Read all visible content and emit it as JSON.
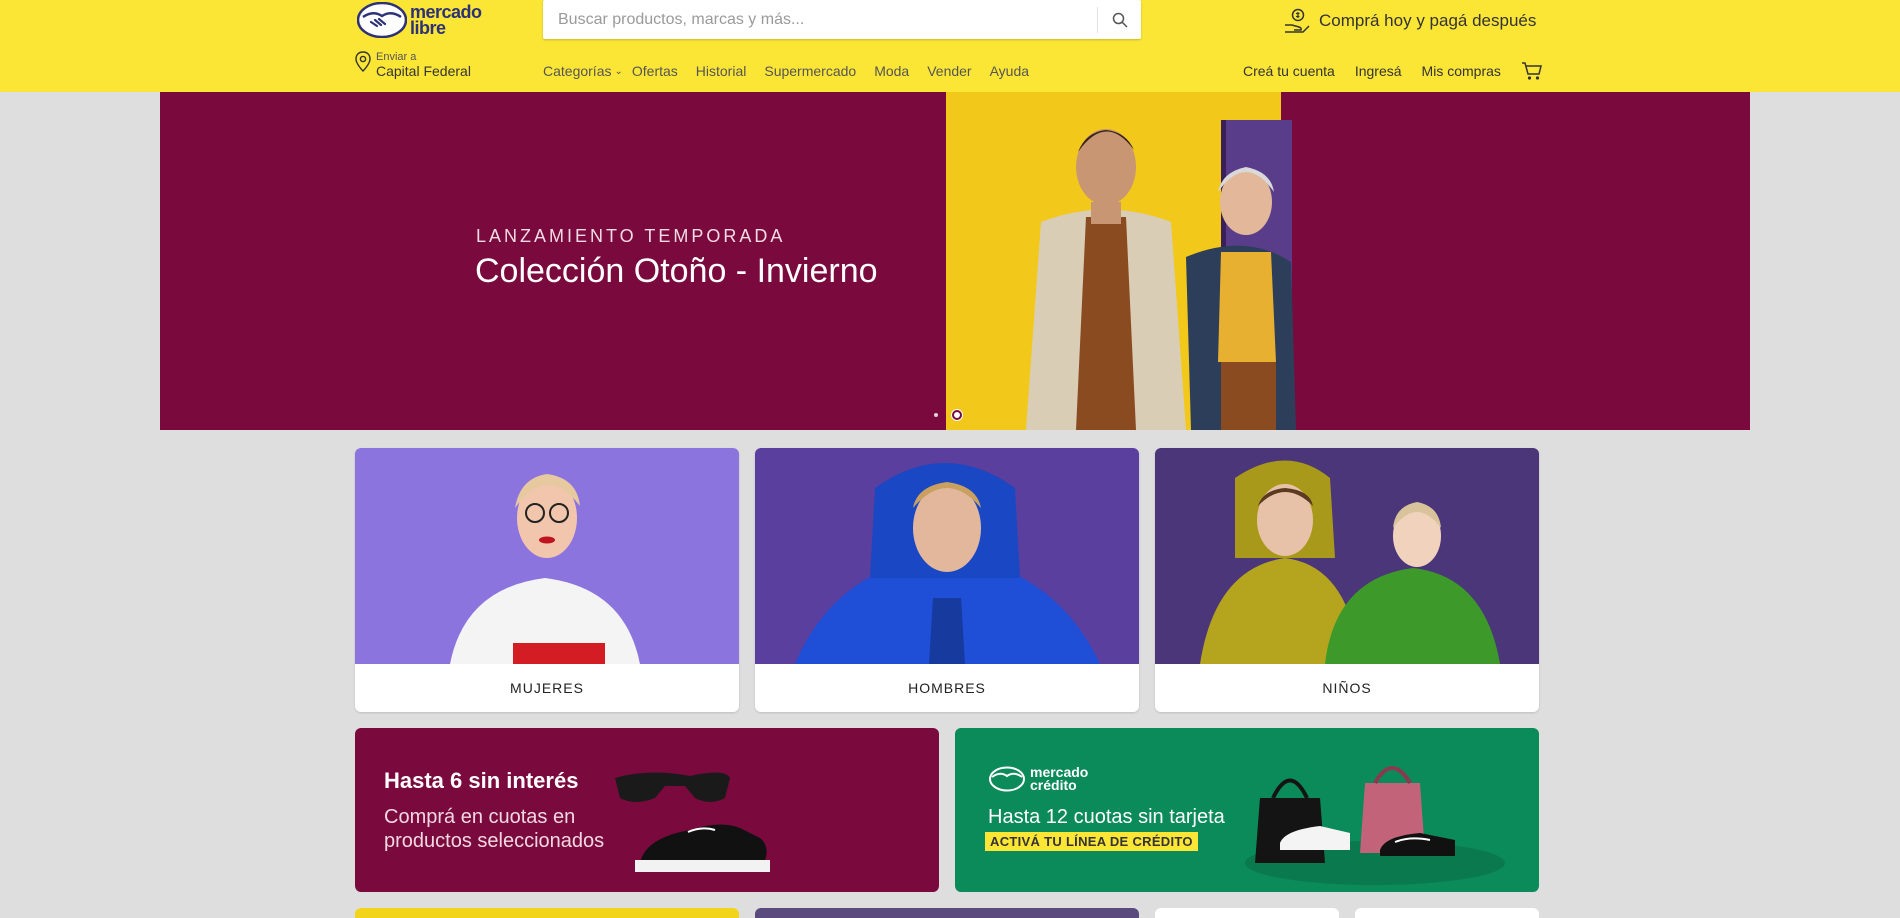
{
  "header": {
    "logo_line1": "mercado",
    "logo_line2": "libre",
    "search_placeholder": "Buscar productos, marcas y más...",
    "promo_text": "Comprá hoy y pagá después",
    "ship_label": "Enviar a",
    "ship_location": "Capital Federal",
    "nav": {
      "categories": "Categorías",
      "offers": "Ofertas",
      "history": "Historial",
      "supermarket": "Supermercado",
      "fashion": "Moda",
      "sell": "Vender",
      "help": "Ayuda"
    },
    "user": {
      "create_account": "Creá tu cuenta",
      "login": "Ingresá",
      "purchases": "Mis compras"
    }
  },
  "hero": {
    "subtitle": "LANZAMIENTO TEMPORADA",
    "title": "Colección Otoño - Invierno",
    "background": "#7a0a3d",
    "slides": 2,
    "active_slide": 2
  },
  "categories": [
    {
      "label": "MUJERES"
    },
    {
      "label": "HOMBRES"
    },
    {
      "label": "NIÑOS"
    }
  ],
  "banners": {
    "installments": {
      "title": "Hasta 6 sin interés",
      "text": "Comprá en cuotas en productos seleccionados"
    },
    "credit": {
      "logo_line1": "mercado",
      "logo_line2": "crédito",
      "title": "Hasta 12 cuotas sin tarjeta",
      "badge": "ACTIVÁ TU LÍNEA DE CRÉDITO"
    }
  },
  "colors": {
    "header": "#fbe635",
    "brand_dark": "#2d3277",
    "wine": "#7a0a3d",
    "green": "#0b8a5a"
  }
}
